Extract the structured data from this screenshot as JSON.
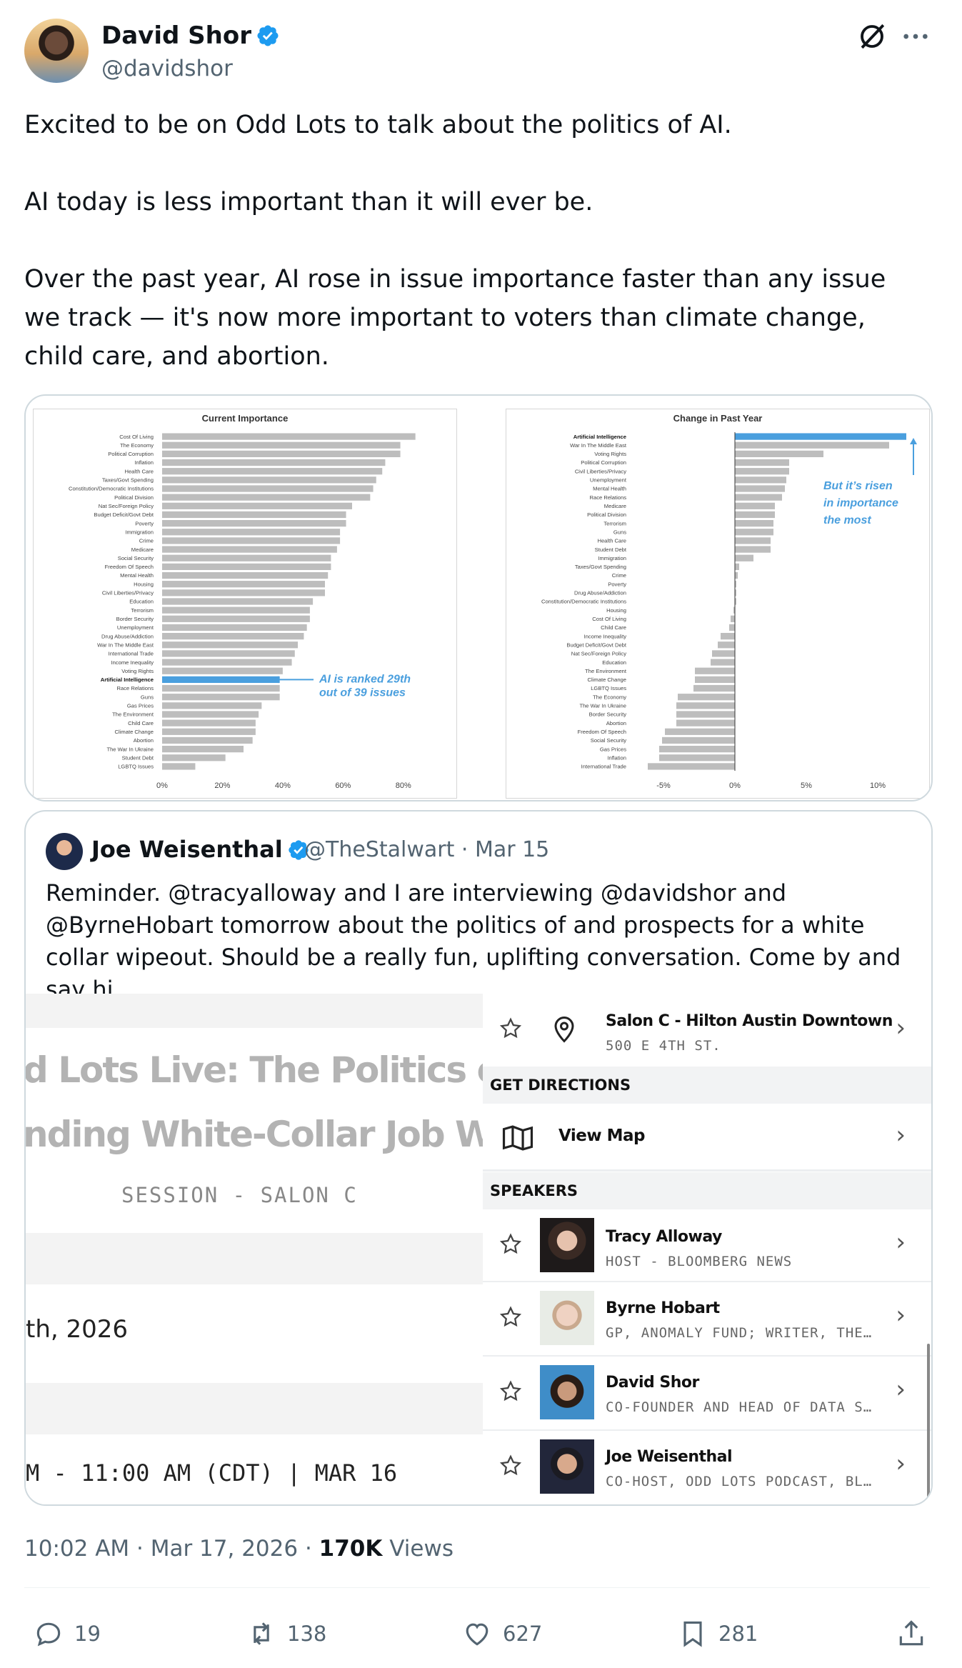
{
  "author": {
    "name": "David Shor",
    "handle": "@davidshor"
  },
  "tweet": {
    "paragraphs": [
      "Excited to be on Odd Lots to talk about the politics of AI.",
      "AI today is less important than it will ever be.",
      "Over the past year, AI rose in issue importance faster than any issue we track — it's now more important to voters than climate change, child care, and abortion."
    ]
  },
  "chart_data": [
    {
      "type": "bar",
      "title": "Current Importance",
      "orientation": "horizontal",
      "categories": [
        "Cost Of Living",
        "The Economy",
        "Political Corruption",
        "Inflation",
        "Health Care",
        "Taxes/Govt Spending",
        "Constitution/Democratic Institutions",
        "Political Division",
        "Nat Sec/Foreign Policy",
        "Budget Deficit/Govt Debt",
        "Poverty",
        "Immigration",
        "Crime",
        "Medicare",
        "Social Security",
        "Freedom Of Speech",
        "Mental Health",
        "Housing",
        "Civil Liberties/Privacy",
        "Education",
        "Terrorism",
        "Border Security",
        "Unemployment",
        "Drug Abuse/Addiction",
        "War In The Middle East",
        "International Trade",
        "Income Inequality",
        "Voting Rights",
        "Artificial Intelligence",
        "Race Relations",
        "Guns",
        "Gas Prices",
        "The Environment",
        "Child Care",
        "Climate Change",
        "Abortion",
        "The War In Ukraine",
        "Student Debt",
        "LGBTQ Issues"
      ],
      "values": [
        84,
        79,
        79,
        74,
        73,
        71,
        70,
        69,
        63,
        61,
        61,
        59,
        59,
        58,
        56,
        56,
        55,
        54,
        54,
        50,
        49,
        49,
        48,
        47,
        45,
        44,
        43,
        40,
        39,
        39,
        39,
        33,
        32,
        31,
        31,
        30,
        27,
        21,
        11
      ],
      "highlight": "Artificial Intelligence",
      "xlim": [
        0,
        90
      ],
      "xticks": [
        "0%",
        "20%",
        "40%",
        "60%",
        "80%"
      ],
      "annotation": [
        "AI is ranked 29th",
        "out of 39 issues"
      ]
    },
    {
      "type": "bar",
      "title": "Change in Past Year",
      "orientation": "horizontal",
      "categories": [
        "Artificial Intelligence",
        "War In The Middle East",
        "Voting Rights",
        "Political Corruption",
        "Civil Liberties/Privacy",
        "Unemployment",
        "Mental Health",
        "Race Relations",
        "Medicare",
        "Political Division",
        "Terrorism",
        "Guns",
        "Health Care",
        "Student Debt",
        "Immigration",
        "Taxes/Govt Spending",
        "Crime",
        "Poverty",
        "Drug Abuse/Addiction",
        "Constitution/Democratic Institutions",
        "Housing",
        "Cost Of Living",
        "Child Care",
        "Income Inequality",
        "Budget Deficit/Govt Debt",
        "Nat Sec/Foreign Policy",
        "Education",
        "The Environment",
        "Climate Change",
        "LGBTQ Issues",
        "The Economy",
        "The War In Ukraine",
        "Border Security",
        "Abortion",
        "Freedom Of Speech",
        "Social Security",
        "Gas Prices",
        "Inflation",
        "International Trade"
      ],
      "values": [
        12.0,
        10.8,
        6.2,
        3.8,
        3.8,
        3.6,
        3.5,
        3.3,
        2.8,
        2.8,
        2.7,
        2.7,
        2.5,
        2.5,
        1.3,
        0.3,
        0.2,
        0.1,
        0.1,
        0.1,
        -0.1,
        -0.3,
        -0.4,
        -1.0,
        -1.2,
        -1.6,
        -1.7,
        -2.8,
        -2.8,
        -2.9,
        -4.0,
        -4.1,
        -4.1,
        -4.1,
        -4.9,
        -5.1,
        -5.3,
        -5.3,
        -6.1
      ],
      "highlight": "Artificial Intelligence",
      "xlim": [
        -6.5,
        13
      ],
      "xticks": [
        "-5%",
        "0%",
        "5%",
        "10%"
      ],
      "annotation": [
        "But it’s risen",
        "in importance",
        "the most"
      ]
    }
  ],
  "quote": {
    "name": "Joe Weisenthal",
    "handle": "@TheStalwart · Mar 15",
    "text": "Reminder. @tracyalloway and I are interviewing @davidshor and @ByrneHobart tomorrow about the politics of and prospects for a white collar wipeout. Should be a really fun, uplifting conversation. Come by and say hi",
    "event": {
      "title_line1": "d Lots Live: The Politics of t",
      "title_line2": "nding White-Collar Job Wip",
      "session": "SESSION - SALON C",
      "date": "th, 2026",
      "time": "M - 11:00 AM (CDT) | MAR 16",
      "location_name": "Salon C - Hilton Austin Downtown",
      "location_address": "500 E 4TH ST.",
      "get_directions": "GET DIRECTIONS",
      "view_map": "View Map",
      "speakers_header": "SPEAKERS",
      "speakers": [
        {
          "name": "Tracy Alloway",
          "role": "HOST - BLOOMBERG NEWS"
        },
        {
          "name": "Byrne Hobart",
          "role": "GP, ANOMALY FUND; WRITER, THE DIFF"
        },
        {
          "name": "David Shor",
          "role": "CO-FOUNDER AND HEAD OF DATA SCIENCE"
        },
        {
          "name": "Joe Weisenthal",
          "role": "CO-HOST, ODD LOTS PODCAST, BLOOMBERG"
        }
      ]
    }
  },
  "meta": {
    "time": "10:02 AM · Mar 17, 2026 · ",
    "views_count": "170K",
    "views_label": " Views"
  },
  "actions": {
    "replies": "19",
    "reposts": "138",
    "likes": "627",
    "bookmarks": "281"
  },
  "colors": {
    "accent": "#1d9bf0",
    "chart_bar": "#bdbdbd",
    "chart_highlight": "#4a9fde"
  }
}
